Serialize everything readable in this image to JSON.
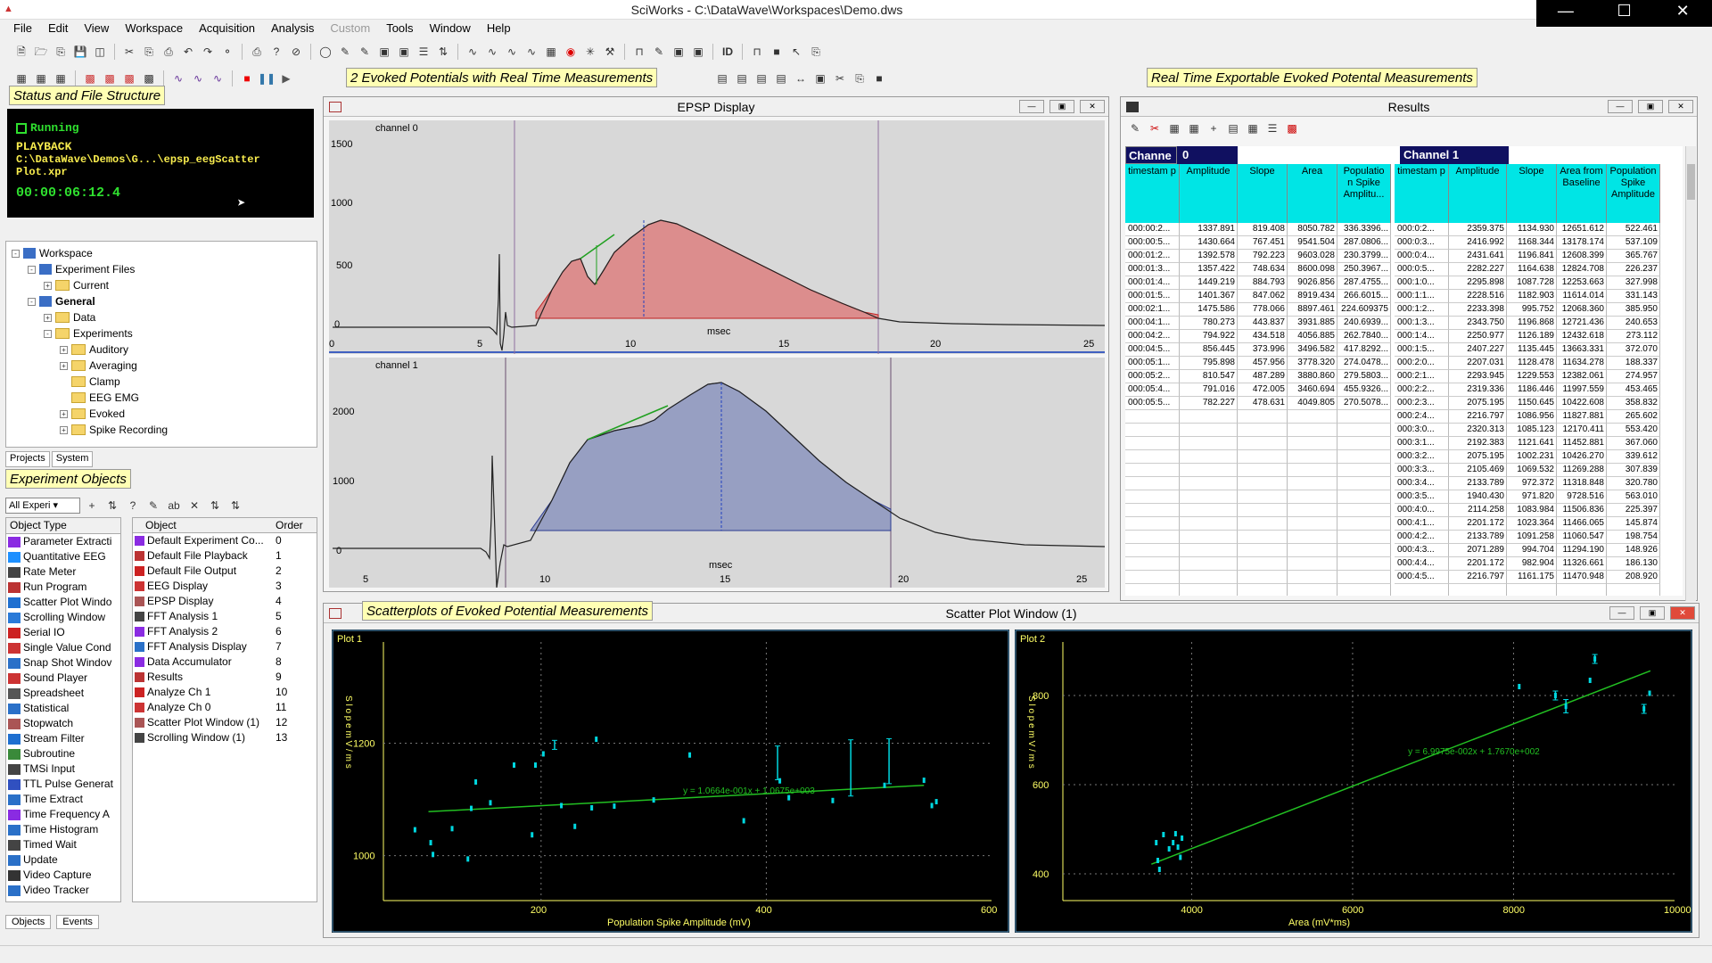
{
  "app": {
    "title": "SciWorks - C:\\DataWave\\Workspaces\\Demo.dws"
  },
  "menu": [
    "File",
    "Edit",
    "View",
    "Workspace",
    "Acquisition",
    "Analysis",
    "Custom",
    "Tools",
    "Window",
    "Help"
  ],
  "labels": {
    "status_tag": "Status and File Structure",
    "evoked_tag": "2 Evoked Potentials with Real Time Measurements",
    "results_tag": "Real Time Exportable Evoked Potental Measurements",
    "objects_tag": "Experiment Objects",
    "scatter_tag": "Scatterplots of Evoked Potential Measurements"
  },
  "toolbar": {
    "id_label": "ID"
  },
  "status": {
    "state": "Running",
    "mode": "PLAYBACK",
    "file": "C:\\DataWave\\Demos\\G...\\epsp_eegScatter Plot.xpr",
    "time": "00:00:06:12.4"
  },
  "tree": [
    {
      "label": "Workspace",
      "level": 0,
      "kind": "ws",
      "pm": "-"
    },
    {
      "label": "Experiment Files",
      "level": 1,
      "kind": "ws",
      "pm": "-"
    },
    {
      "label": "Current",
      "level": 2,
      "kind": "fld",
      "pm": "+"
    },
    {
      "label": "General",
      "level": 1,
      "kind": "ws",
      "pm": "-",
      "bold": true
    },
    {
      "label": "Data",
      "level": 2,
      "kind": "fld",
      "pm": "+"
    },
    {
      "label": "Experiments",
      "level": 2,
      "kind": "fld",
      "pm": "-"
    },
    {
      "label": "Auditory",
      "level": 3,
      "kind": "fld",
      "pm": "+"
    },
    {
      "label": "Averaging",
      "level": 3,
      "kind": "fld",
      "pm": "+"
    },
    {
      "label": "Clamp",
      "level": 3,
      "kind": "fld",
      "pm": ""
    },
    {
      "label": "EEG EMG",
      "level": 3,
      "kind": "fld",
      "pm": ""
    },
    {
      "label": "Evoked",
      "level": 3,
      "kind": "fld",
      "pm": "+"
    },
    {
      "label": "Spike Recording",
      "level": 3,
      "kind": "fld",
      "pm": "+"
    }
  ],
  "panel_tabs": [
    "Projects",
    "System"
  ],
  "objects": {
    "filter": "All Experi",
    "type_header": "Object Type",
    "object_header": "Object",
    "order_header": "Order",
    "types": [
      "Parameter Extracti",
      "Quantitative EEG",
      "Rate Meter",
      "Run Program",
      "Scatter Plot Windo",
      "Scrolling Window",
      "Serial IO",
      "Single Value Cond",
      "Snap Shot Windov",
      "Sound Player",
      "Spreadsheet",
      "Statistical",
      "Stopwatch",
      "Stream Filter",
      "Subroutine",
      "TMSi Input",
      "TTL Pulse Generat",
      "Time Extract",
      "Time Frequency A",
      "Time Histogram",
      "Timed Wait",
      "Update",
      "Video Capture",
      "Video Tracker"
    ],
    "rows": [
      {
        "name": "Default Experiment Co...",
        "order": "0"
      },
      {
        "name": "Default File Playback",
        "order": "1"
      },
      {
        "name": "Default File Output",
        "order": "2"
      },
      {
        "name": "EEG Display",
        "order": "3"
      },
      {
        "name": "EPSP Display",
        "order": "4"
      },
      {
        "name": "FFT Analysis 1",
        "order": "5"
      },
      {
        "name": "FFT Analysis 2",
        "order": "6"
      },
      {
        "name": "FFT Analysis Display",
        "order": "7"
      },
      {
        "name": "Data Accumulator",
        "order": "8"
      },
      {
        "name": "Results",
        "order": "9"
      },
      {
        "name": "Analyze Ch 1",
        "order": "10"
      },
      {
        "name": "Analyze Ch 0",
        "order": "11"
      },
      {
        "name": "Scatter Plot Window (1)",
        "order": "12"
      },
      {
        "name": "Scrolling Window (1)",
        "order": "13"
      }
    ],
    "bottom_tabs": [
      "Objects",
      "Events"
    ]
  },
  "epsp": {
    "title": "EPSP Display",
    "ch0": {
      "label": "channel 0",
      "yticks": [
        "1500",
        "1000",
        "500",
        "0"
      ],
      "xticks": [
        "0",
        "5",
        "10",
        "15",
        "20",
        "25"
      ],
      "xlabel": "msec"
    },
    "ch1": {
      "label": "channel 1",
      "yticks": [
        "2000",
        "1000",
        "0"
      ],
      "xticks": [
        "5",
        "10",
        "15",
        "20",
        "25"
      ],
      "xlabel": "msec"
    },
    "colors": {
      "ch0_fill": "#e05050",
      "ch1_fill": "#4a5aa8"
    }
  },
  "results": {
    "title": "Results",
    "channel0": {
      "label": "Channe",
      "num": "0"
    },
    "channel1": {
      "label": "Channel 1"
    },
    "headers0": [
      "timestam p",
      "Amplitude",
      "Slope",
      "Area",
      "Populatio n Spike Amplitu..."
    ],
    "headers1": [
      "timestam p",
      "Amplitude",
      "Slope",
      "Area from Baseline",
      "Population Spike Amplitude"
    ],
    "rows0": [
      [
        "000:00:2...",
        "1337.891",
        "819.408",
        "8050.782",
        "336.3396..."
      ],
      [
        "000:00:5...",
        "1430.664",
        "767.451",
        "9541.504",
        "287.0806..."
      ],
      [
        "000:01:2...",
        "1392.578",
        "792.223",
        "9603.028",
        "230.3799..."
      ],
      [
        "000:01:3...",
        "1357.422",
        "748.634",
        "8600.098",
        "250.3967..."
      ],
      [
        "000:01:4...",
        "1449.219",
        "884.793",
        "9026.856",
        "287.4755..."
      ],
      [
        "000:01:5...",
        "1401.367",
        "847.062",
        "8919.434",
        "266.6015..."
      ],
      [
        "000:02:1...",
        "1475.586",
        "778.066",
        "8897.461",
        "224.609375"
      ],
      [
        "000:04:1...",
        "780.273",
        "443.837",
        "3931.885",
        "240.6939..."
      ],
      [
        "000:04:2...",
        "794.922",
        "434.518",
        "4056.885",
        "262.7840..."
      ],
      [
        "000:04:5...",
        "856.445",
        "373.996",
        "3496.582",
        "417.8292..."
      ],
      [
        "000:05:1...",
        "795.898",
        "457.956",
        "3778.320",
        "274.0478..."
      ],
      [
        "000:05:2...",
        "810.547",
        "487.289",
        "3880.860",
        "279.5803..."
      ],
      [
        "000:05:4...",
        "791.016",
        "472.005",
        "3460.694",
        "455.9326..."
      ],
      [
        "000:05:5...",
        "782.227",
        "478.631",
        "4049.805",
        "270.5078..."
      ]
    ],
    "rows1": [
      [
        "000:0:2...",
        "2359.375",
        "1134.930",
        "12651.612",
        "522.461"
      ],
      [
        "000:0:3...",
        "2416.992",
        "1168.344",
        "13178.174",
        "537.109"
      ],
      [
        "000:0:4...",
        "2431.641",
        "1196.841",
        "12608.399",
        "365.767"
      ],
      [
        "000:0:5...",
        "2282.227",
        "1164.638",
        "12824.708",
        "226.237"
      ],
      [
        "000:1:0...",
        "2295.898",
        "1087.728",
        "12253.663",
        "327.998"
      ],
      [
        "000:1:1...",
        "2228.516",
        "1182.903",
        "11614.014",
        "331.143"
      ],
      [
        "000:1:2...",
        "2233.398",
        "995.752",
        "12068.360",
        "385.950"
      ],
      [
        "000:1:3...",
        "2343.750",
        "1196.868",
        "12721.436",
        "240.653"
      ],
      [
        "000:1:4...",
        "2250.977",
        "1126.189",
        "12432.618",
        "273.112"
      ],
      [
        "000:1:5...",
        "2407.227",
        "1135.445",
        "13663.331",
        "372.070"
      ],
      [
        "000:2:0...",
        "2207.031",
        "1128.478",
        "11634.278",
        "188.337"
      ],
      [
        "000:2:1...",
        "2293.945",
        "1229.553",
        "12382.061",
        "274.957"
      ],
      [
        "000:2:2...",
        "2319.336",
        "1186.446",
        "11997.559",
        "453.465"
      ],
      [
        "000:2:3...",
        "2075.195",
        "1150.645",
        "10422.608",
        "358.832"
      ],
      [
        "000:2:4...",
        "2216.797",
        "1086.956",
        "11827.881",
        "265.602"
      ],
      [
        "000:3:0...",
        "2320.313",
        "1085.123",
        "12170.411",
        "553.420"
      ],
      [
        "000:3:1...",
        "2192.383",
        "1121.641",
        "11452.881",
        "367.060"
      ],
      [
        "000:3:2...",
        "2075.195",
        "1002.231",
        "10426.270",
        "339.612"
      ],
      [
        "000:3:3...",
        "2105.469",
        "1069.532",
        "11269.288",
        "307.839"
      ],
      [
        "000:3:4...",
        "2133.789",
        "972.372",
        "11318.848",
        "320.780"
      ],
      [
        "000:3:5...",
        "1940.430",
        "971.820",
        "9728.516",
        "563.010"
      ],
      [
        "000:4:0...",
        "2114.258",
        "1083.984",
        "11506.836",
        "225.397"
      ],
      [
        "000:4:1...",
        "2201.172",
        "1023.364",
        "11466.065",
        "145.874"
      ],
      [
        "000:4:2...",
        "2133.789",
        "1091.258",
        "11060.547",
        "198.754"
      ],
      [
        "000:4:3...",
        "2071.289",
        "994.704",
        "11294.190",
        "148.926"
      ],
      [
        "000:4:4...",
        "2201.172",
        "982.904",
        "11326.661",
        "186.130"
      ],
      [
        "000:4:5...",
        "2216.797",
        "1161.175",
        "11470.948",
        "208.920"
      ]
    ]
  },
  "scatter": {
    "title": "Scatter Plot Window (1)"
  },
  "chart_data": [
    {
      "type": "scatter",
      "title": "Plot 1",
      "xlabel": "Population Spike Amplitude (mV)",
      "ylabel": "S l o p e   m V / m s",
      "xlim": [
        60,
        600
      ],
      "ylim": [
        920,
        1380
      ],
      "xticks": [
        "200",
        "400",
        "600"
      ],
      "yticks": [
        "1000",
        "1200"
      ],
      "fit": {
        "label": "y = 1.0664e-001x + 1.0675e+003",
        "slope": 0.10664,
        "intercept": 1067.5,
        "x0": 100,
        "x1": 540
      },
      "points": [
        [
          88,
          1046
        ],
        [
          102,
          1023
        ],
        [
          104,
          1002
        ],
        [
          121,
          1048
        ],
        [
          135,
          994
        ],
        [
          138,
          1084
        ],
        [
          142,
          1131
        ],
        [
          155,
          1094
        ],
        [
          176,
          1161
        ],
        [
          192,
          1037
        ],
        [
          195,
          1161
        ],
        [
          202,
          1181
        ],
        [
          218,
          1089
        ],
        [
          230,
          1052
        ],
        [
          245,
          1085
        ],
        [
          249,
          1207
        ],
        [
          265,
          1088
        ],
        [
          300,
          1099
        ],
        [
          332,
          1179
        ],
        [
          380,
          1062
        ],
        [
          412,
          1133
        ],
        [
          420,
          1103
        ],
        [
          459,
          1098
        ],
        [
          505,
          1125
        ],
        [
          540,
          1134
        ],
        [
          547,
          1089
        ],
        [
          551,
          1096
        ]
      ],
      "errorbars": [
        [
          212,
          1197,
          8
        ],
        [
          410,
          1165,
          30
        ],
        [
          475,
          1156,
          50
        ],
        [
          509,
          1168,
          40
        ]
      ],
      "color": "#00d8e0"
    },
    {
      "type": "scatter",
      "title": "Plot 2",
      "xlabel": "Area (mV*ms)",
      "ylabel": "S l o p e   m V / m s",
      "xlim": [
        2400,
        10000
      ],
      "ylim": [
        340,
        920
      ],
      "xticks": [
        "4000",
        "6000",
        "8000",
        "10000"
      ],
      "yticks": [
        "400",
        "600",
        "800"
      ],
      "fit": {
        "label": "y = 6.9975e-002x + 1.7670e+002",
        "slope": 0.069975,
        "intercept": 176.7,
        "x0": 3500,
        "x1": 9700
      },
      "points": [
        [
          3560,
          470
        ],
        [
          3580,
          430
        ],
        [
          3600,
          410
        ],
        [
          3650,
          488
        ],
        [
          3720,
          456
        ],
        [
          3770,
          470
        ],
        [
          3800,
          490
        ],
        [
          3830,
          460
        ],
        [
          3860,
          437
        ],
        [
          3880,
          480
        ],
        [
          8070,
          820
        ],
        [
          8520,
          800
        ],
        [
          8650,
          776
        ],
        [
          8950,
          834
        ],
        [
          9010,
          882
        ],
        [
          9620,
          770
        ],
        [
          9690,
          805
        ]
      ],
      "errorbars": [
        [
          8520,
          800,
          10
        ],
        [
          8650,
          776,
          15
        ],
        [
          9010,
          882,
          10
        ],
        [
          9620,
          770,
          10
        ]
      ],
      "color": "#00d8e0"
    }
  ]
}
